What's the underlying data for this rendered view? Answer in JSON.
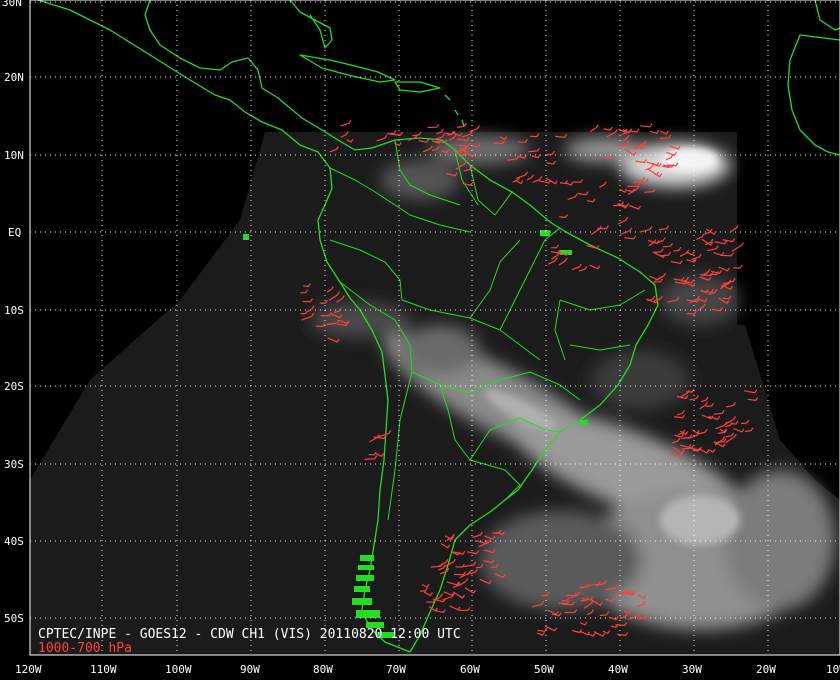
{
  "lat_labels": [
    "30N",
    "20N",
    "10N",
    "EQ",
    "10S",
    "20S",
    "30S",
    "40S",
    "50S"
  ],
  "lon_labels": [
    "120W",
    "110W",
    "100W",
    "90W",
    "80W",
    "70W",
    "60W",
    "50W",
    "40W",
    "30W",
    "20W",
    "10W"
  ],
  "caption": "CPTEC/INPE - GOES12 - CDW CH1 (VIS) 20110820 12:00 UTC",
  "legend": "1000-700 hPa",
  "colors": {
    "background": "#000000",
    "coastline": "#22dd22",
    "grid": "#ffffff",
    "wind_vectors": "#ff4040",
    "label_text": "#ffffff"
  }
}
